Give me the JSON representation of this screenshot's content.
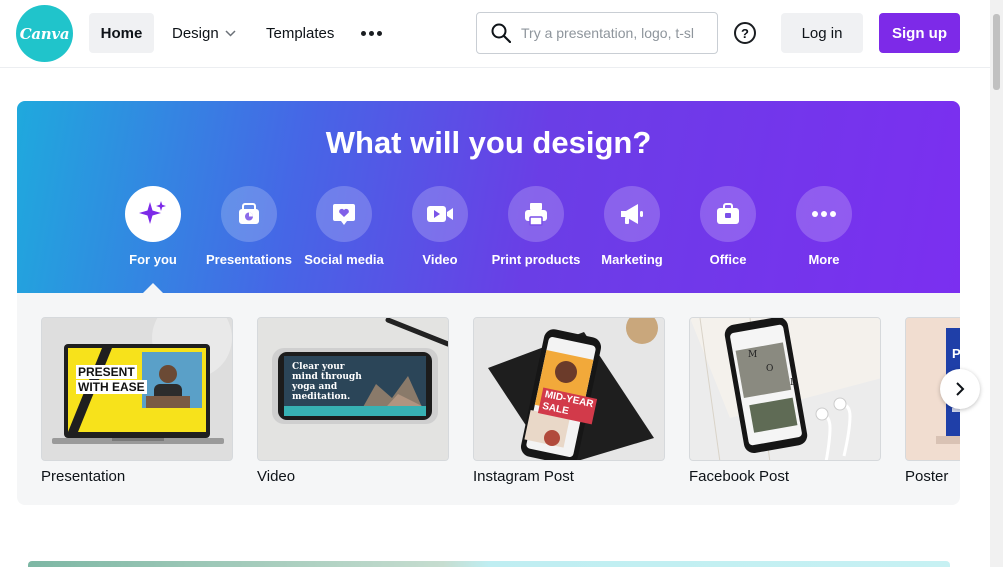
{
  "header": {
    "logo_text": "Canva",
    "nav": {
      "home": "Home",
      "design": "Design",
      "templates": "Templates"
    },
    "search_placeholder": "Try a presentation, logo, t-sl",
    "help": "?",
    "login": "Log in",
    "signup": "Sign up"
  },
  "hero": {
    "title": "What will you design?",
    "categories": [
      {
        "label": "For you",
        "icon": "sparkle-icon"
      },
      {
        "label": "Presentations",
        "icon": "presentation-icon"
      },
      {
        "label": "Social media",
        "icon": "heart-chat-icon"
      },
      {
        "label": "Video",
        "icon": "video-camera-icon"
      },
      {
        "label": "Print products",
        "icon": "printer-icon"
      },
      {
        "label": "Marketing",
        "icon": "megaphone-icon"
      },
      {
        "label": "Office",
        "icon": "briefcase-icon"
      },
      {
        "label": "More",
        "icon": "more-dots-icon"
      }
    ]
  },
  "templates": [
    {
      "label": "Presentation",
      "thumb_text": [
        "PRESENT",
        "WITH EASE"
      ]
    },
    {
      "label": "Video",
      "thumb_text": [
        "Clear your",
        "mind through",
        "yoga and",
        "meditation."
      ]
    },
    {
      "label": "Instagram Post",
      "thumb_text": [
        "MID-YEAR",
        "SALE"
      ]
    },
    {
      "label": "Facebook Post",
      "thumb_text": [
        "M",
        "O",
        "D"
      ]
    },
    {
      "label": "Poster",
      "thumb_text": [
        "P"
      ]
    }
  ],
  "colors": {
    "brand_purple": "#7d2ae8",
    "logo_teal": "#20c4cb",
    "hero_start": "#1fa9dd",
    "hero_end": "#7b2ff0"
  }
}
